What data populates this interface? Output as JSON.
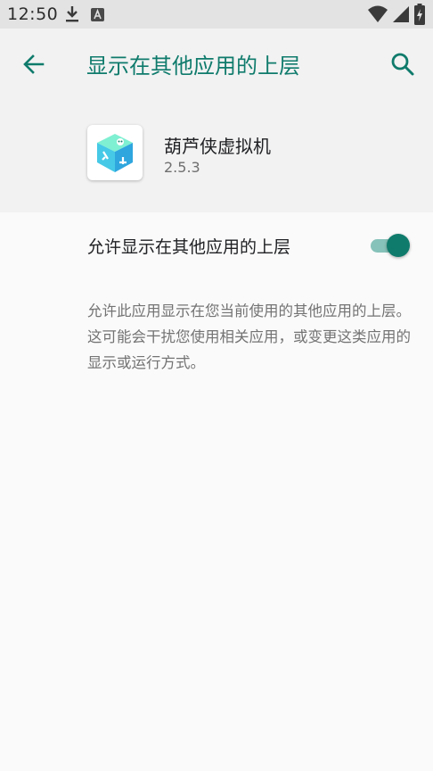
{
  "status_bar": {
    "time": "12:50",
    "icons": [
      "download-icon",
      "a-notification-icon",
      "wifi-icon",
      "cell-signal-icon",
      "battery-charging-icon"
    ]
  },
  "header": {
    "title": "显示在其他应用的上层",
    "back_icon": "arrow-back-icon",
    "search_icon": "search-icon"
  },
  "app": {
    "name": "葫芦侠虚拟机",
    "version": "2.5.3",
    "icon": "app-cube-icon"
  },
  "permission": {
    "label": "允许显示在其他应用的上层",
    "enabled": true
  },
  "description": "允许此应用显示在您当前使用的其他应用的上层。这可能会干扰您使用相关应用，或变更这类应用的显示或运行方式。",
  "colors": {
    "accent": "#0f7b6c",
    "toggle_track": "#86c2b9",
    "header_bg": "#f2f2f2",
    "status_bar_bg": "#e3e3e3"
  }
}
